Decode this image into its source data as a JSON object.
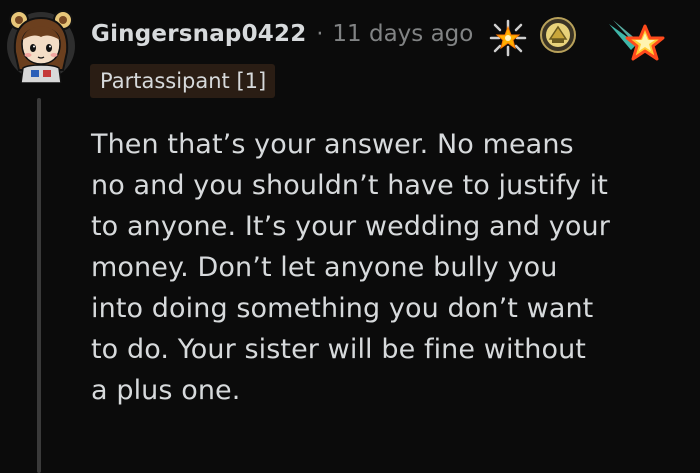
{
  "comment": {
    "username": "Gingersnap0422",
    "separator": "·",
    "timestamp": "11 days ago",
    "flair": "Partassipant [1]",
    "body_lines": [
      "Then that’s your answer. No means",
      "no and you shouldn’t have to justify it",
      "to anyone. It’s your wedding and your",
      "money. Don’t let anyone bully you",
      "into doing something you don’t want",
      "to do. Your sister will be fine without",
      "a plus one."
    ]
  },
  "awards": [
    {
      "icon": "starburst-award-icon"
    },
    {
      "icon": "helpful-award-icon"
    },
    {
      "icon": "shooting-star-award-icon"
    }
  ],
  "colors": {
    "background": "#0b0b0b",
    "text": "#d7dadc",
    "muted": "#818384",
    "flair_bg": "#2a1d14",
    "thread_line": "#3a3a3a"
  }
}
